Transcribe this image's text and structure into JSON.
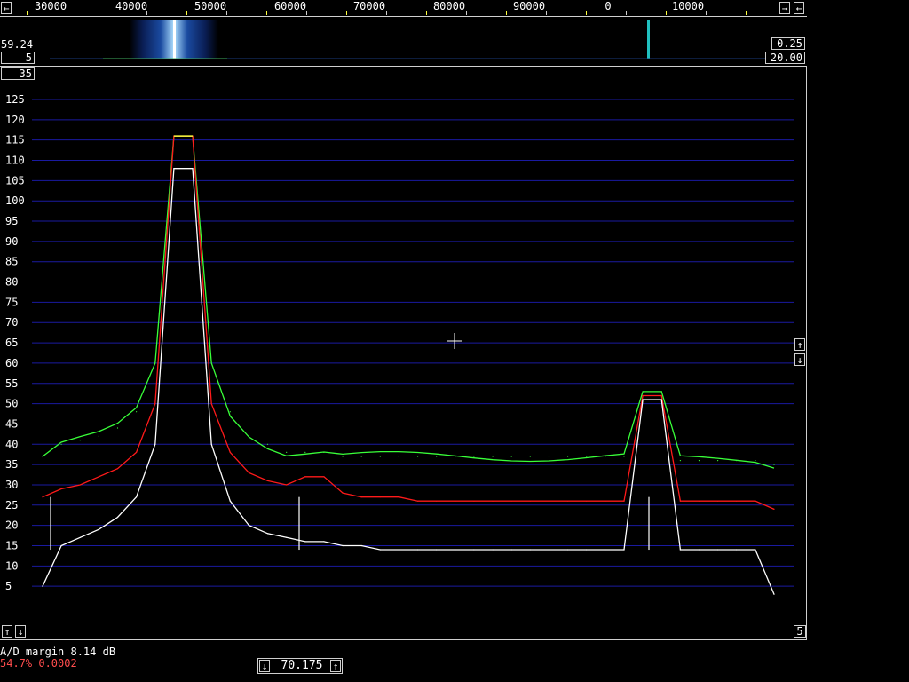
{
  "frequency_scale": {
    "labels": [
      "30000",
      "40000",
      "50000",
      "60000",
      "70000",
      "80000",
      "90000",
      "0",
      "10000"
    ]
  },
  "waterfall": {
    "left_value": "59.24",
    "left_box": "5",
    "right_top_box": "0.25",
    "right_bottom_box": "20.00"
  },
  "spectrum": {
    "top_left_box": "35",
    "bottom_right_box": "5",
    "y_axis_ticks": [
      "125",
      "120",
      "115",
      "110",
      "105",
      "100",
      "95",
      "90",
      "85",
      "80",
      "75",
      "70",
      "65",
      "60",
      "55",
      "50",
      "45",
      "40",
      "35",
      "30",
      "25",
      "20",
      "15",
      "10",
      "5"
    ]
  },
  "status": {
    "ad_margin": "A/D margin 8.14 dB",
    "percent": "54.7% 0.0002",
    "center_freq": "70.175"
  },
  "icons": {
    "arrow_left": "arrow-left-icon",
    "arrow_right": "arrow-right-icon",
    "arrow_up": "arrow-up-icon",
    "arrow_down": "arrow-down-icon",
    "crosshair": "crosshair-icon"
  },
  "colors": {
    "grid": "#1a1aa0",
    "green_trace": "#39ff39",
    "red_trace": "#ff1a1a",
    "white_trace": "#ffffff",
    "yellow_peak": "#ffff40",
    "warning_text": "#ff4d4d"
  },
  "chart_data": {
    "type": "line",
    "title": "",
    "xlabel": "",
    "ylabel": "",
    "ylim": [
      0,
      125
    ],
    "grid": true,
    "series": [
      {
        "values": [
          37,
          40,
          41,
          42,
          44,
          48,
          60,
          116,
          116,
          60,
          48,
          43,
          40,
          38,
          38,
          38,
          37,
          37,
          37,
          37,
          37,
          37,
          37,
          37,
          37,
          37,
          37,
          37,
          37,
          37,
          37,
          37,
          53,
          53,
          36,
          36,
          36,
          36,
          36,
          35
        ]
      },
      {
        "values": [
          27,
          29,
          30,
          32,
          34,
          38,
          50,
          116,
          116,
          50,
          38,
          33,
          31,
          30,
          32,
          32,
          28,
          27,
          27,
          27,
          26,
          26,
          26,
          26,
          26,
          26,
          26,
          26,
          26,
          26,
          26,
          26,
          52,
          52,
          26,
          26,
          26,
          26,
          26,
          24
        ]
      },
      {
        "values": [
          5,
          15,
          17,
          19,
          22,
          27,
          40,
          108,
          108,
          40,
          26,
          20,
          18,
          17,
          16,
          16,
          15,
          15,
          14,
          14,
          14,
          14,
          14,
          14,
          14,
          14,
          14,
          14,
          14,
          14,
          14,
          14,
          51,
          51,
          14,
          14,
          14,
          14,
          14,
          3
        ]
      }
    ]
  }
}
